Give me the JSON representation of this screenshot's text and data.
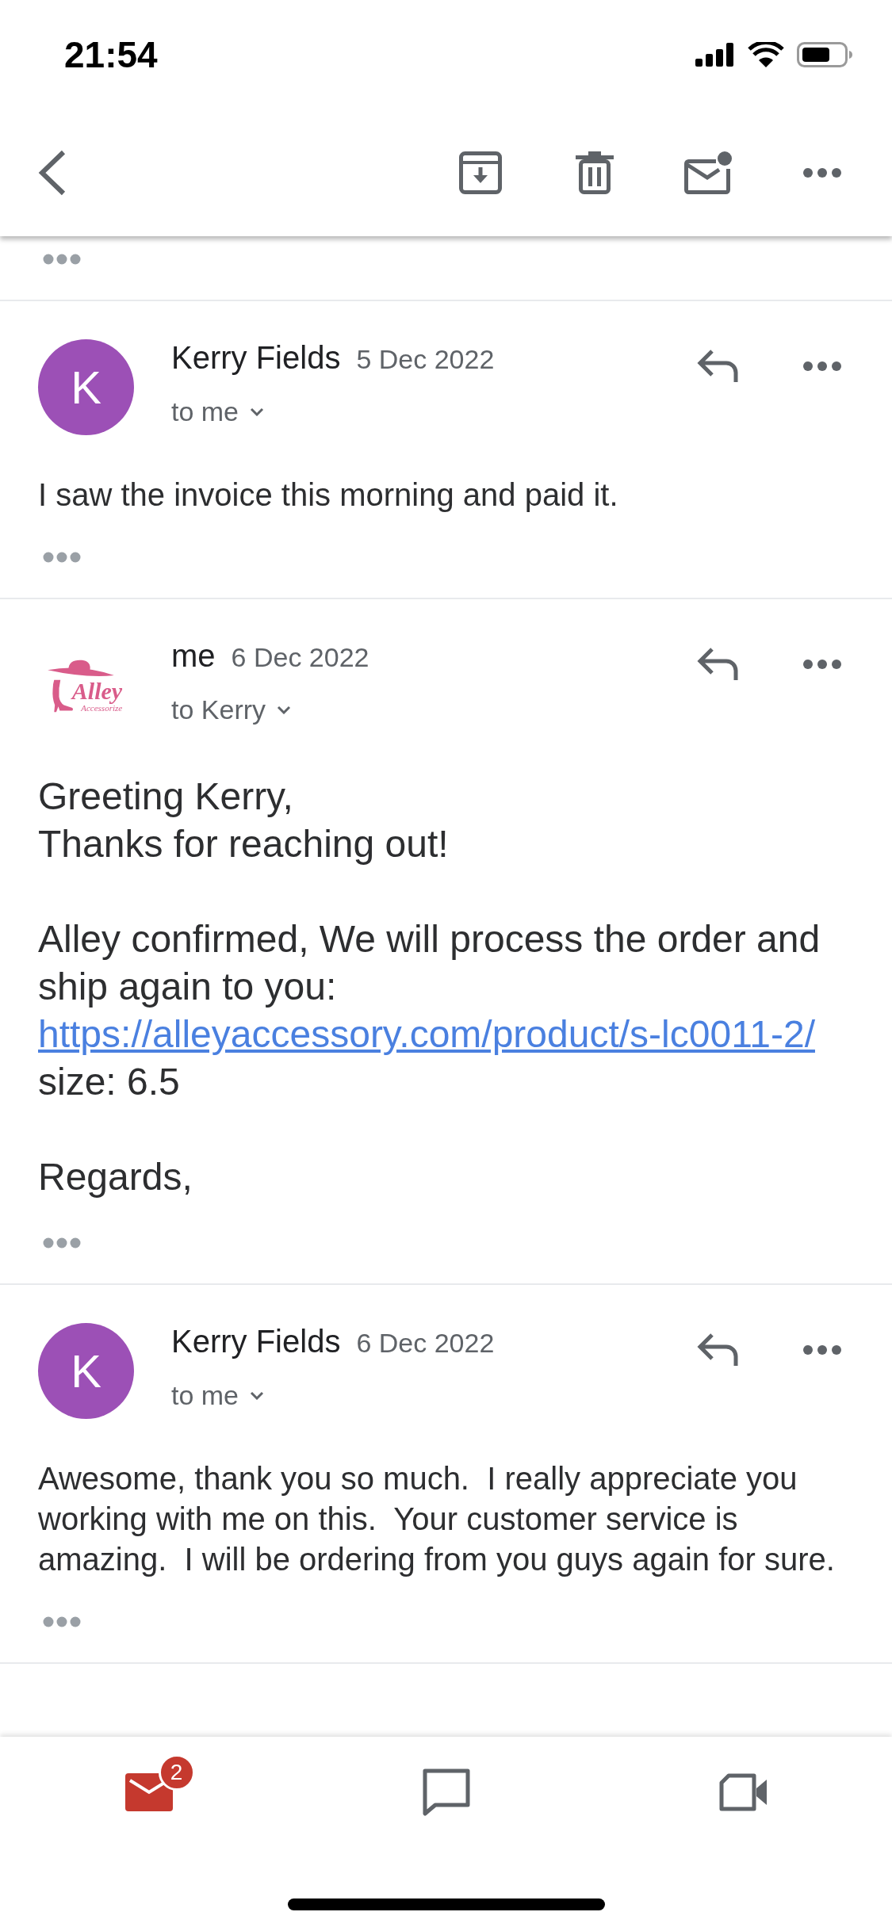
{
  "status_bar": {
    "time": "21:54"
  },
  "messages": [
    {
      "kind": "plain",
      "sender": "Kerry Fields",
      "date": "5 Dec 2022",
      "recipient": "to me",
      "avatar": {
        "kind": "initial",
        "letter": "K"
      },
      "body": [
        [
          {
            "text": "I saw the invoice this morning and paid it."
          }
        ]
      ]
    },
    {
      "kind": "formatted",
      "sender": "me",
      "date": "6 Dec 2022",
      "recipient": "to Kerry",
      "avatar": {
        "kind": "logo",
        "title": "Alley",
        "subtitle": "Accessorize"
      },
      "body": [
        [
          {
            "text": "Greeting Kerry,"
          },
          {
            "text": "Thanks for reaching out!"
          }
        ],
        [
          {
            "text": "Alley confirmed, We will process the order and ship again to you:",
            "link": "https://alleyaccessory.com/product/s-lc0011-2/"
          },
          {
            "text": "size: 6.5"
          }
        ],
        [
          {
            "text": "Regards,"
          }
        ]
      ]
    },
    {
      "kind": "plain",
      "sender": "Kerry Fields",
      "date": "6 Dec 2022",
      "recipient": "to me",
      "avatar": {
        "kind": "initial",
        "letter": "K"
      },
      "body": [
        [
          {
            "text": "Awesome, thank you so much.  I really appreciate you working with me on this.  Your customer service is amazing.  I will be ordering from you guys again for sure."
          }
        ]
      ]
    }
  ],
  "bottom_nav": [
    {
      "kind": "mail",
      "selected": true,
      "badge": "2"
    },
    {
      "kind": "chat",
      "selected": false
    },
    {
      "kind": "video",
      "selected": false
    }
  ]
}
